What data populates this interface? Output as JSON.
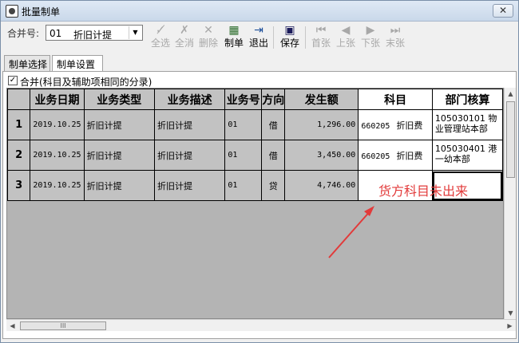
{
  "window": {
    "title": "批量制单",
    "close_symbol": "✕"
  },
  "toolbar": {
    "merge_label": "合并号:",
    "merge_select": {
      "code": "01",
      "name": "折旧计提"
    },
    "buttons": [
      {
        "label": "全选",
        "icon": "select-all-icon",
        "enabled": false
      },
      {
        "label": "全消",
        "icon": "deselect-all-icon",
        "enabled": false
      },
      {
        "label": "删除",
        "icon": "delete-icon",
        "enabled": false
      },
      {
        "label": "制单",
        "icon": "voucher-icon",
        "enabled": true
      },
      {
        "label": "退出",
        "icon": "exit-icon",
        "enabled": true
      },
      {
        "label": "保存",
        "icon": "save-icon",
        "enabled": true
      },
      {
        "label": "首张",
        "icon": "first-icon",
        "enabled": false
      },
      {
        "label": "上张",
        "icon": "prev-icon",
        "enabled": false
      },
      {
        "label": "下张",
        "icon": "next-icon",
        "enabled": false
      },
      {
        "label": "末张",
        "icon": "last-icon",
        "enabled": false
      }
    ]
  },
  "tabs": [
    {
      "label": "制单选择"
    },
    {
      "label": "制单设置"
    }
  ],
  "merge_option": {
    "checked": true,
    "label": "合并(科目及辅助项相同的分录)"
  },
  "grid": {
    "columns": [
      "业务日期",
      "业务类型",
      "业务描述",
      "业务号",
      "方向",
      "发生额",
      "科目",
      "部门核算"
    ],
    "rows": [
      {
        "no": "1",
        "date": "2019.10.25",
        "type": "折旧计提",
        "desc": "折旧计提",
        "biz_no": "01",
        "dir": "借",
        "amount": "1,296.00",
        "subj_code": "660205",
        "subj_name": "折旧费",
        "dept": "105030101  物业管理站本部"
      },
      {
        "no": "2",
        "date": "2019.10.25",
        "type": "折旧计提",
        "desc": "折旧计提",
        "biz_no": "01",
        "dir": "借",
        "amount": "3,450.00",
        "subj_code": "660205",
        "subj_name": "折旧费",
        "dept": "105030401  港一幼本部"
      },
      {
        "no": "3",
        "date": "2019.10.25",
        "type": "折旧计提",
        "desc": "折旧计提",
        "biz_no": "01",
        "dir": "贷",
        "amount": "4,746.00",
        "subj_code": "",
        "subj_name": "",
        "dept": ""
      }
    ]
  },
  "annotation": {
    "text": "货方科目未出来",
    "color": "#e23a3a"
  },
  "scrollbar_glyphs": {
    "up": "▲",
    "down": "▼",
    "left": "◀",
    "right": "▶",
    "grip": "III"
  }
}
